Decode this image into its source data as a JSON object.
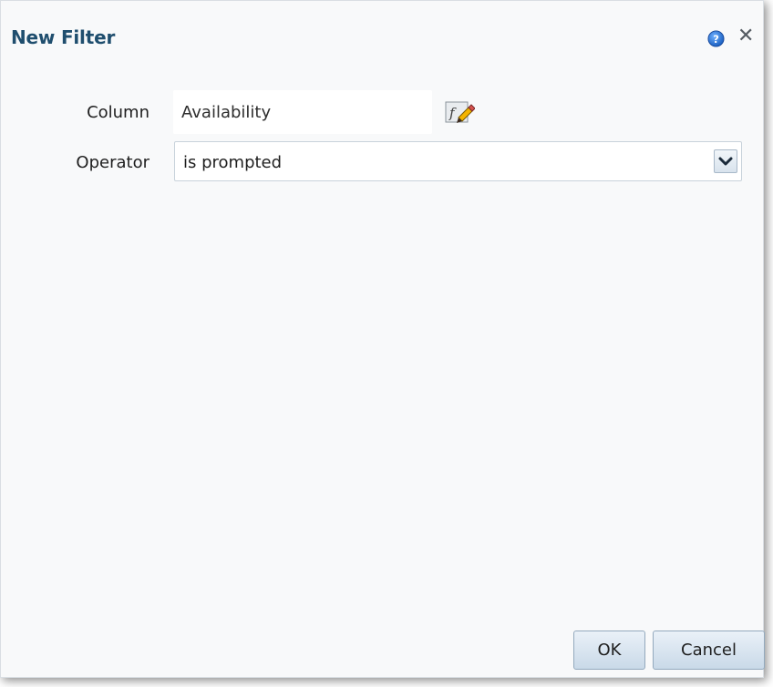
{
  "dialog": {
    "title": "New Filter",
    "help_icon": "help-icon",
    "close_icon": "close-icon",
    "close_glyph": "✕"
  },
  "form": {
    "column_label": "Column",
    "column_value": "Availability",
    "column_edit_icon": "formula-edit-icon",
    "operator_label": "Operator",
    "operator_value": "is prompted",
    "operator_dropdown_icon": "chevron-down-icon"
  },
  "buttons": {
    "ok_label": "OK",
    "cancel_label": "Cancel"
  },
  "colors": {
    "title": "#1f4e6e",
    "dialog_bg": "#f8f9fa",
    "button_bg": "#c9d9e8",
    "help_icon": "#1f6fd1"
  }
}
